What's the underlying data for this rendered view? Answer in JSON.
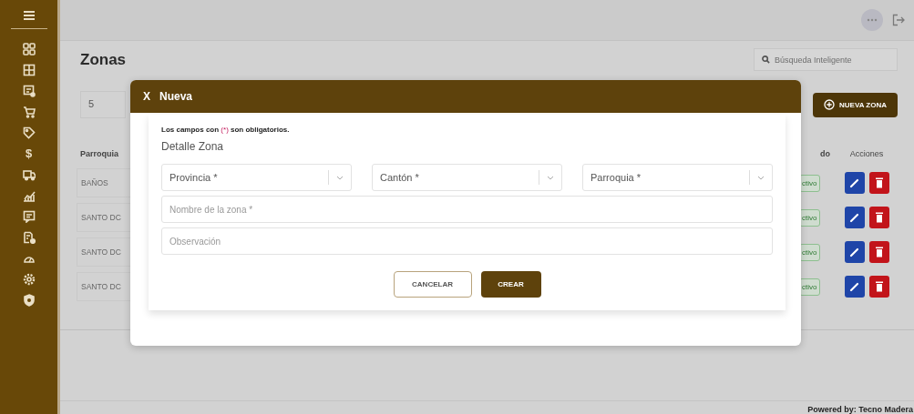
{
  "sidebar": {
    "currency_symbol": "$"
  },
  "page": {
    "title": "Zonas",
    "search": {
      "placeholder": "Búsqueda Inteligente"
    },
    "page_size": "5",
    "new_button": "NUEVA ZONA"
  },
  "table": {
    "columns": [
      "Parroquia",
      "do",
      "Acciones"
    ],
    "rows": [
      {
        "parroquia": "BAÑOS",
        "estado": "ctivo"
      },
      {
        "parroquia": "SANTO DC",
        "estado": "ctivo"
      },
      {
        "parroquia": "SANTO DC",
        "estado": "ctivo"
      },
      {
        "parroquia": "SANTO DC",
        "estado": "ctivo"
      }
    ]
  },
  "modal": {
    "close": "X",
    "title": "Nueva",
    "note": {
      "before": "Los campos con ",
      "mark": "(*)",
      "after": " son obligatorios."
    },
    "section": "Detalle Zona",
    "selects": [
      {
        "placeholder": "Provincia *"
      },
      {
        "placeholder": "Cantón *"
      },
      {
        "placeholder": "Parroquia *"
      }
    ],
    "inputs": [
      {
        "placeholder": "Nombre de la zona *"
      },
      {
        "placeholder": "Observación"
      }
    ],
    "buttons": [
      {
        "label": "CANCELAR",
        "kind": "secondary"
      },
      {
        "label": "CREAR",
        "kind": "primary"
      }
    ]
  },
  "footer": "Powered by: Tecno Madera"
}
